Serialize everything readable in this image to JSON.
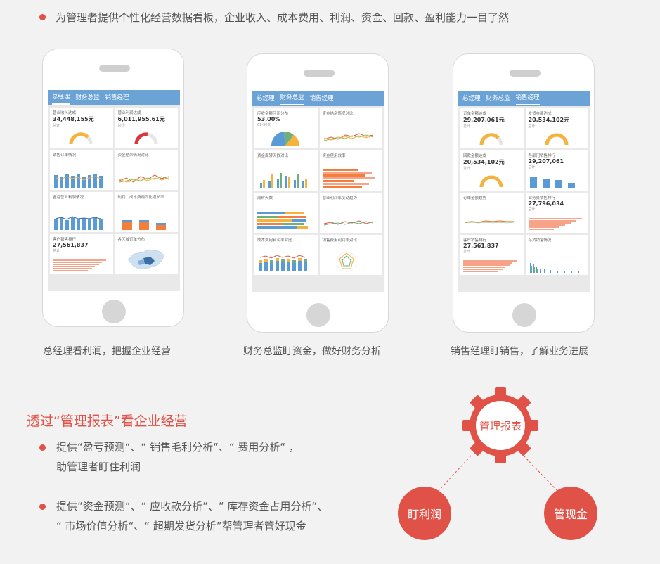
{
  "intro": "为管理者提供个性化经营数据看板，企业收入、成本费用、利润、资金、回款、盈利能力一目了然",
  "phones": [
    {
      "tabs": [
        "总经理",
        "财务总监",
        "销售经理"
      ],
      "active": 0,
      "cards": [
        {
          "title": "营业收入达成",
          "value": "34,448,155元",
          "sub": "总计"
        },
        {
          "title": "营业利润达成",
          "value": "6,011,955.61元",
          "sub": "总计"
        },
        {
          "title": "销售订单情况",
          "value": "",
          "sub": ""
        },
        {
          "title": "资金结余情况对比",
          "value": "",
          "sub": ""
        },
        {
          "title": "各月营业利润情况",
          "value": "",
          "sub": ""
        },
        {
          "title": "利润、成本费用同比增长率",
          "value": "",
          "sub": ""
        },
        {
          "title": "客户销售排行",
          "value": "27,561,837",
          "sub": "总计"
        },
        {
          "title": "各区域订单分布",
          "value": "",
          "sub": ""
        }
      ],
      "caption": "总经理看利润，把握企业经营"
    },
    {
      "tabs": [
        "总经理",
        "财务总监",
        "销售经理"
      ],
      "active": 1,
      "cards": [
        {
          "title": "应收金额区间分布",
          "value": "53.00%",
          "sub": "61-90天"
        },
        {
          "title": "资金结余情况对比",
          "value": "",
          "sub": ""
        },
        {
          "title": "资金周转天数对比",
          "value": "",
          "sub": ""
        },
        {
          "title": "资金使用效率",
          "value": "",
          "sub": ""
        },
        {
          "title": "周转天数",
          "value": "",
          "sub": ""
        },
        {
          "title": "营业利润率变动趋势",
          "value": "",
          "sub": ""
        },
        {
          "title": "成本费用利润率对比",
          "value": "",
          "sub": ""
        },
        {
          "title": "销售费用利润率对比",
          "value": "",
          "sub": ""
        }
      ],
      "caption": "财务总监盯资金，做好财务分析"
    },
    {
      "tabs": [
        "总经理",
        "财务总监",
        "销售经理"
      ],
      "active": 2,
      "cards": [
        {
          "title": "订单金额达成",
          "value": "29,207,061元",
          "sub": "总计"
        },
        {
          "title": "发货金额达成",
          "value": "20,534,102元",
          "sub": "总计"
        },
        {
          "title": "回款金额达成",
          "value": "20,534,102元",
          "sub": "总计"
        },
        {
          "title": "各部门销售排行",
          "value": "29,207,061",
          "sub": "总计"
        },
        {
          "title": "订单金额趋势",
          "value": "",
          "sub": ""
        },
        {
          "title": "业务员销售排行",
          "value": "27,796,034",
          "sub": "总计"
        },
        {
          "title": "客户销售排行",
          "value": "27,561,837",
          "sub": "总计"
        },
        {
          "title": "存货销售情况",
          "value": "",
          "sub": ""
        }
      ],
      "caption": "销售经理盯销售，了解业务进展"
    }
  ],
  "section": {
    "title": "透过“管理报表”看企业经营",
    "bullet1_line1": "提供“盈亏预测“、“ 销售毛利分析“、“ 费用分析“ ，",
    "bullet1_line2": "助管理者盯住利润",
    "bullet2_line1": "提供“资金预测“、“ 应收款分析“、“ 库存资金占用分析“、",
    "bullet2_line2": "“ 市场价值分析“、“ 超期发货分析”帮管理者管好现金"
  },
  "diagram": {
    "center": "管理报表",
    "left": "盯利润",
    "right": "管现金",
    "color": "#e05247"
  }
}
